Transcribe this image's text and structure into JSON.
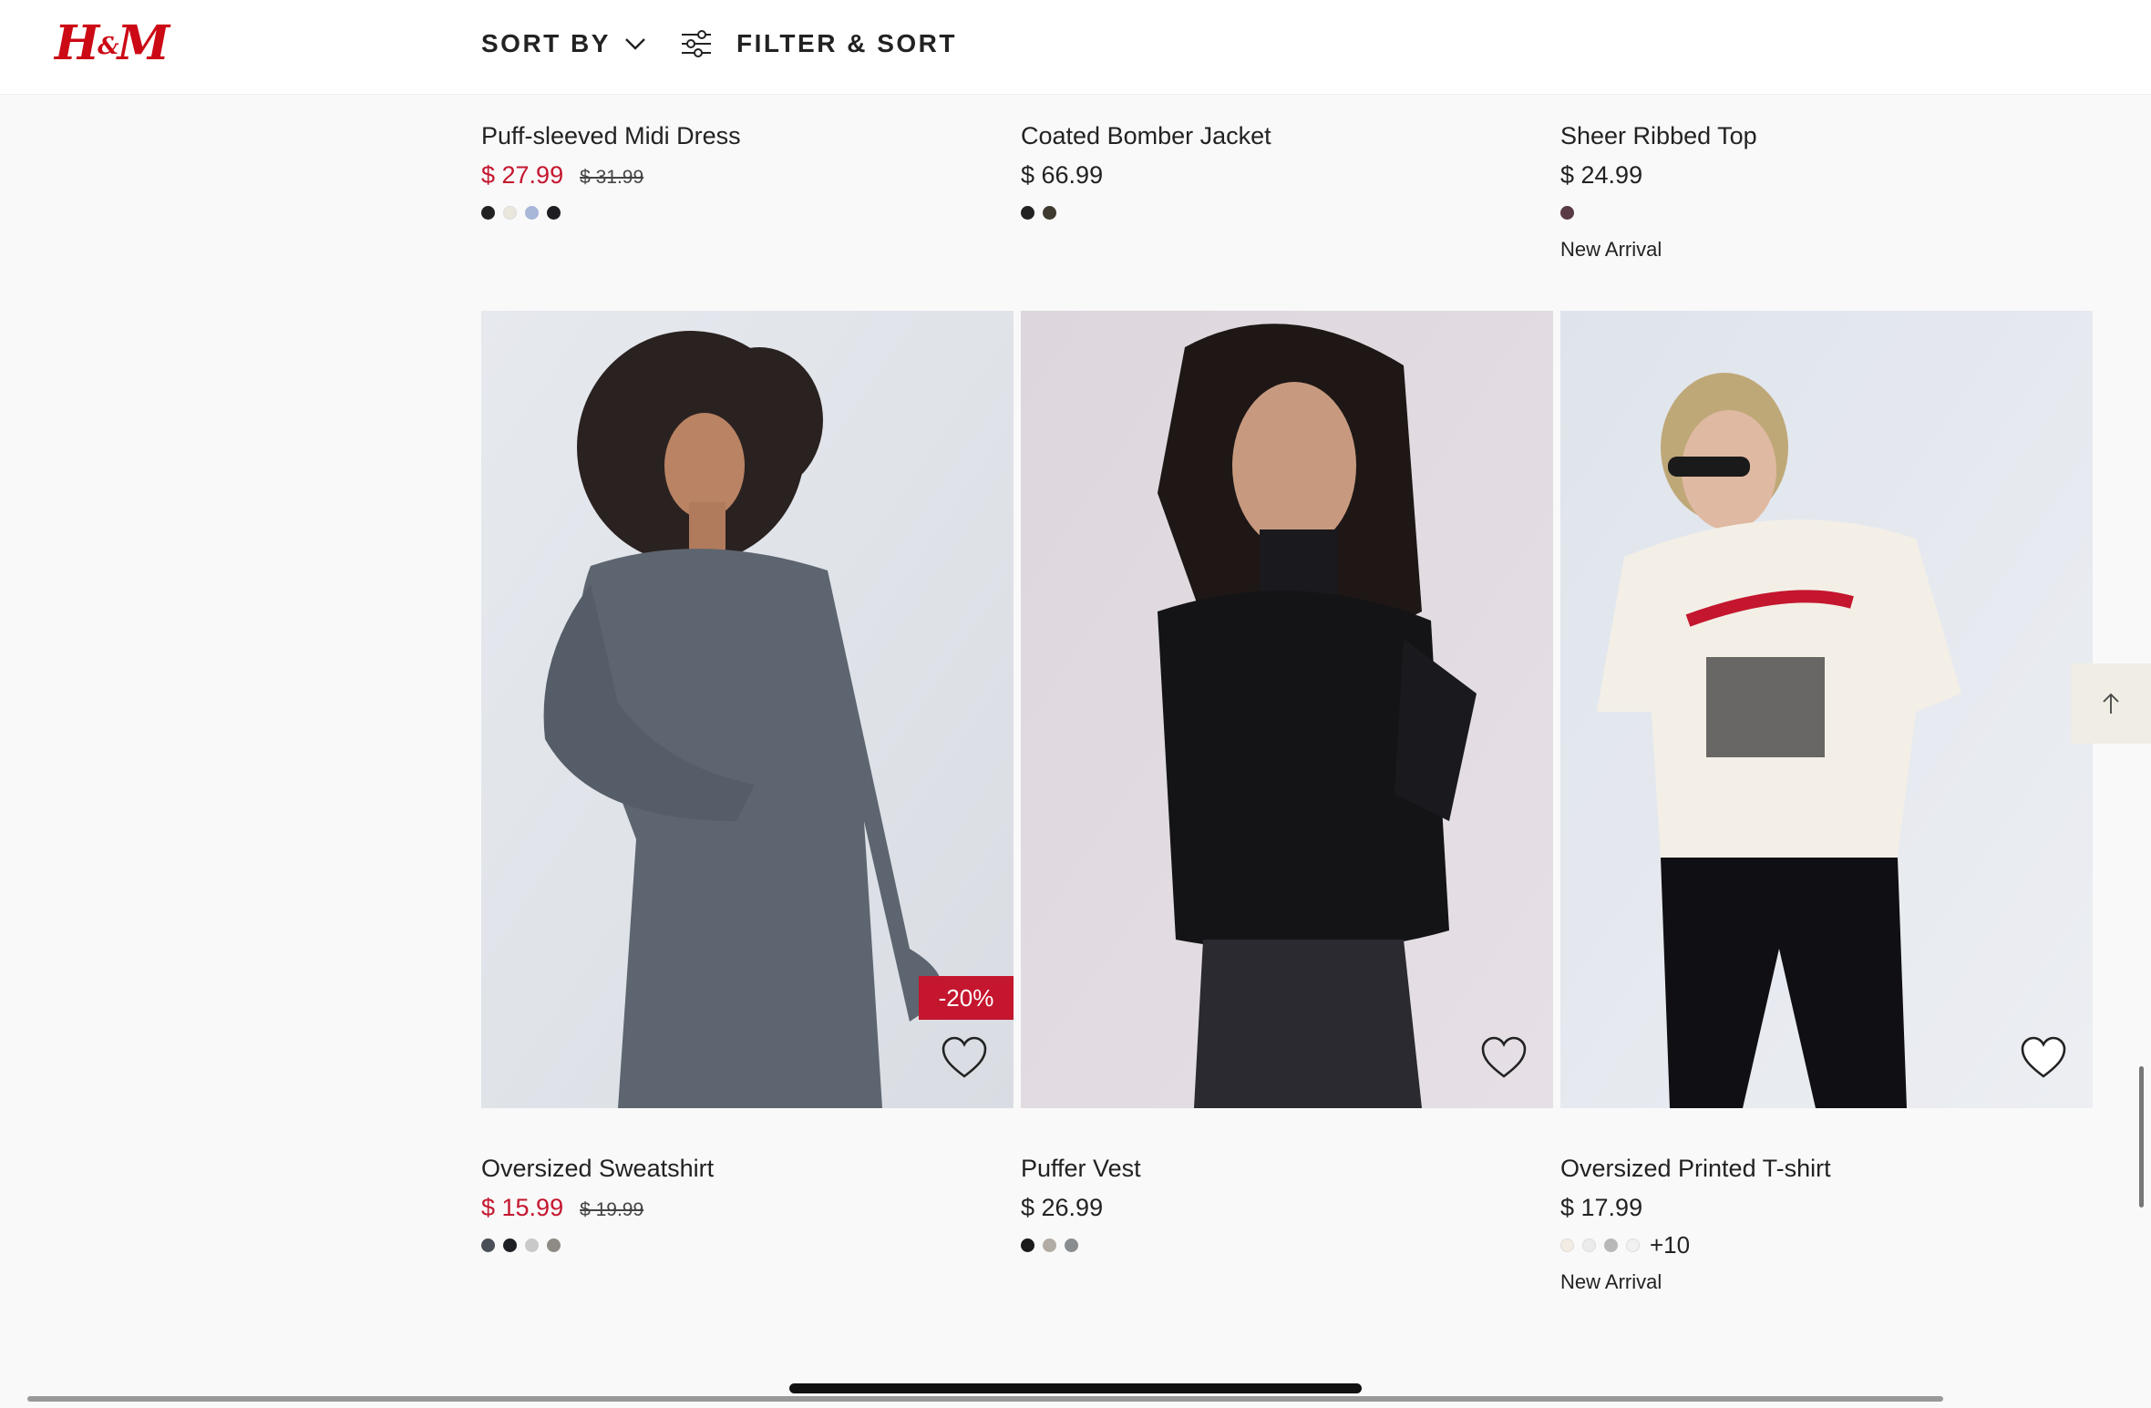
{
  "header": {
    "logo": "H&M",
    "sort_label": "SORT BY",
    "filter_label": "FILTER & SORT"
  },
  "products_top": [
    {
      "name": "Puff-sleeved Midi Dress",
      "price": "$ 27.99",
      "old_price": "$ 31.99",
      "on_sale": true,
      "swatches": [
        "#222222",
        "#e9e6dc",
        "#a8b6d8",
        "#1e1e22"
      ],
      "more_colors": "",
      "tag": ""
    },
    {
      "name": "Coated Bomber Jacket",
      "price": "$ 66.99",
      "old_price": "",
      "on_sale": false,
      "swatches": [
        "#222222",
        "#3e3a30"
      ],
      "more_colors": "",
      "tag": ""
    },
    {
      "name": "Sheer Ribbed Top",
      "price": "$ 24.99",
      "old_price": "",
      "on_sale": false,
      "swatches": [
        "#5a3a44"
      ],
      "more_colors": "",
      "tag": "New Arrival"
    }
  ],
  "products_bottom": [
    {
      "name": "Oversized Sweatshirt",
      "price": "$ 15.99",
      "old_price": "$ 19.99",
      "on_sale": true,
      "discount": "-20%",
      "swatches": [
        "#4a4e56",
        "#1e2026",
        "#c9c9c9",
        "#8e8a84"
      ],
      "more_colors": "",
      "tag": ""
    },
    {
      "name": "Puffer Vest",
      "price": "$ 26.99",
      "old_price": "",
      "on_sale": false,
      "discount": "",
      "swatches": [
        "#1b1b1b",
        "#b3aca4",
        "#8a8d90"
      ],
      "more_colors": "",
      "tag": ""
    },
    {
      "name": "Oversized Printed T-shirt",
      "price": "$ 17.99",
      "old_price": "",
      "on_sale": false,
      "discount": "",
      "swatches": [
        "#f2ece2",
        "#ecebeb",
        "#b8b8b8",
        "#f1f1f1"
      ],
      "more_colors": "+10",
      "tag": "New Arrival"
    }
  ],
  "colors": {
    "brand": "#cc0a16",
    "sale": "#c4162e"
  },
  "icons": {
    "sort": "chevron-down-icon",
    "filter": "sliders-icon",
    "favorite": "heart-icon",
    "back_to_top": "arrow-up-icon"
  }
}
